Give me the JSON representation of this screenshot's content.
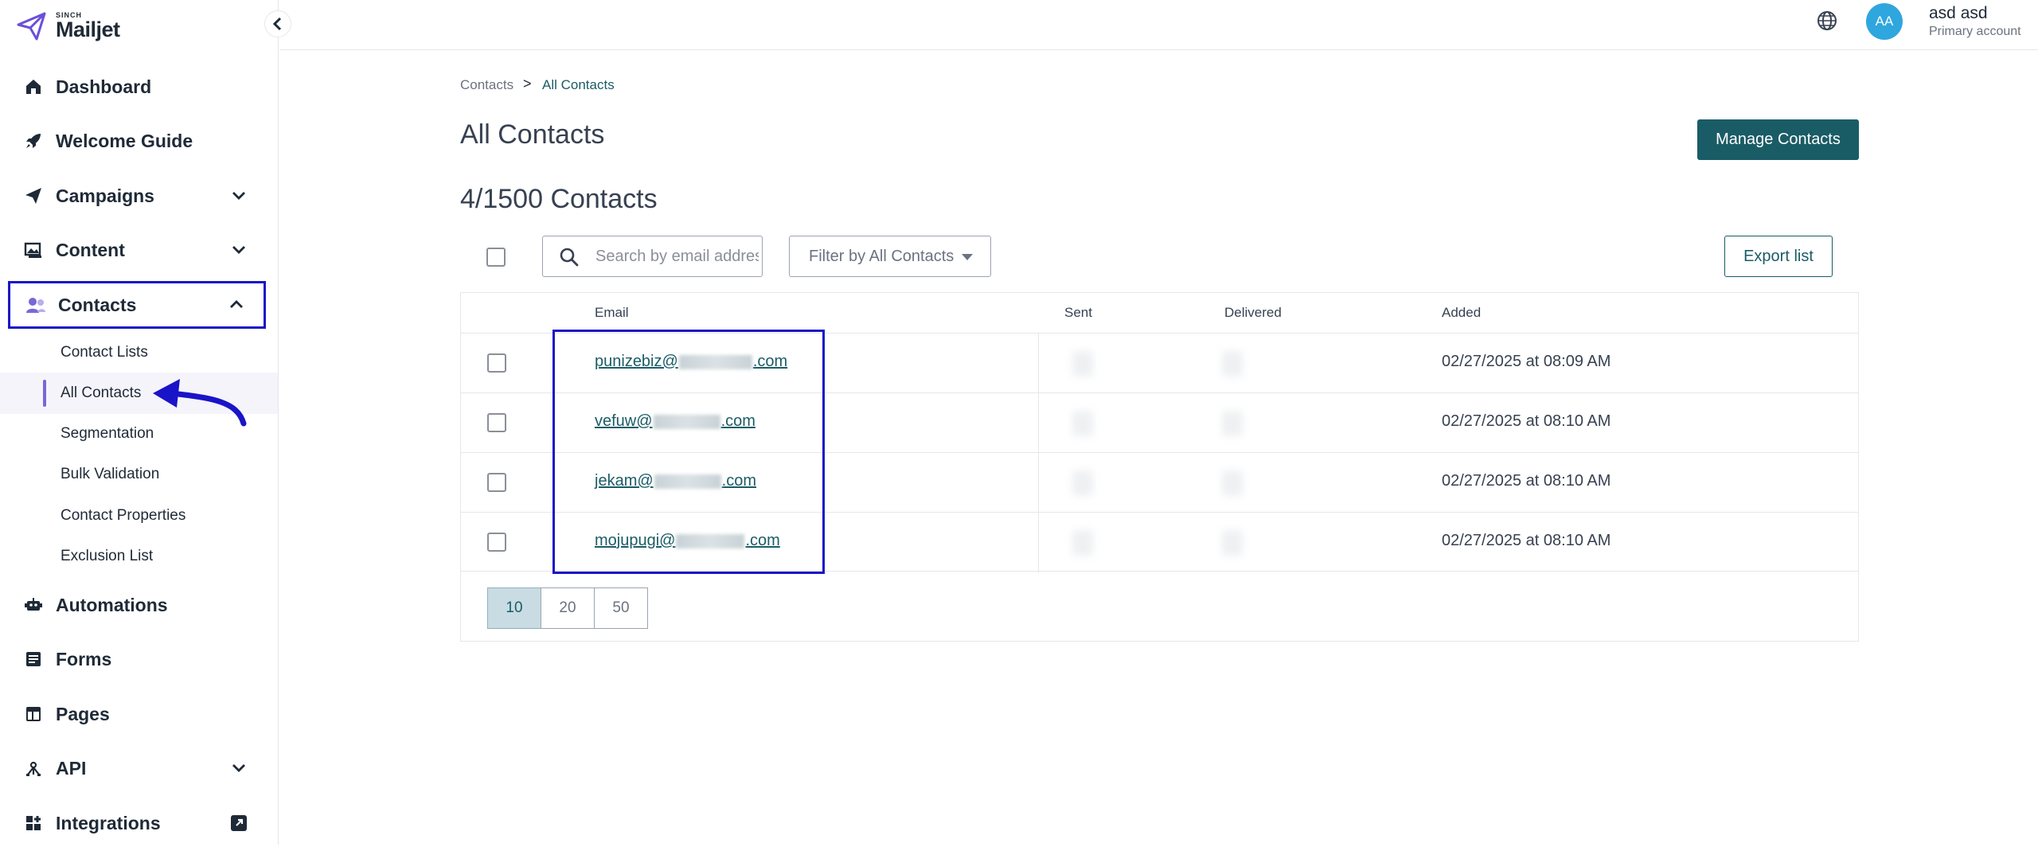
{
  "logo": {
    "brand": "SINCH",
    "name": "Mailjet"
  },
  "sidebar": {
    "collapse_icon": "chevron-left-icon",
    "items": [
      {
        "label": "Dashboard",
        "icon": "home-icon"
      },
      {
        "label": "Welcome Guide",
        "icon": "rocket-icon"
      },
      {
        "label": "Campaigns",
        "icon": "paper-plane-icon"
      },
      {
        "label": "Content",
        "icon": "image-icon"
      },
      {
        "label": "Contacts",
        "icon": "contacts-icon"
      },
      {
        "label": "Automations",
        "icon": "robot-icon"
      },
      {
        "label": "Forms",
        "icon": "form-icon"
      },
      {
        "label": "Pages",
        "icon": "layout-icon"
      },
      {
        "label": "API",
        "icon": "api-icon"
      },
      {
        "label": "Integrations",
        "icon": "grid-plus-icon"
      }
    ],
    "contacts_sub": [
      "Contact Lists",
      "All Contacts",
      "Segmentation",
      "Bulk Validation",
      "Contact Properties",
      "Exclusion List"
    ]
  },
  "topbar": {
    "avatar_initials": "AA",
    "user_name": "asd asd",
    "account_type": "Primary account"
  },
  "breadcrumb": {
    "parent": "Contacts",
    "separator": ">",
    "current": "All Contacts"
  },
  "page": {
    "title": "All Contacts",
    "count_title": "4/1500 Contacts",
    "manage_button": "Manage Contacts",
    "search_placeholder": "Search by email address",
    "filter_label": "Filter by All Contacts",
    "export_button": "Export list"
  },
  "table": {
    "headers": {
      "email": "Email",
      "sent": "Sent",
      "delivered": "Delivered",
      "added": "Added"
    },
    "rows": [
      {
        "email_prefix": "punizebiz@",
        "email_suffix": ".com",
        "added": "02/27/2025 at 08:09 AM"
      },
      {
        "email_prefix": "vefuw@",
        "email_suffix": ".com",
        "added": "02/27/2025 at 08:10 AM"
      },
      {
        "email_prefix": "jekam@",
        "email_suffix": ".com",
        "added": "02/27/2025 at 08:10 AM"
      },
      {
        "email_prefix": "mojupugi@",
        "email_suffix": ".com",
        "added": "02/27/2025 at 08:10 AM"
      }
    ]
  },
  "pagination": {
    "options": [
      "10",
      "20",
      "50"
    ],
    "selected": "10"
  },
  "colors": {
    "accent": "#1a5c66",
    "annotation": "#1a14c8",
    "avatar": "#2fa6de",
    "logo": "#6b4fd8"
  }
}
